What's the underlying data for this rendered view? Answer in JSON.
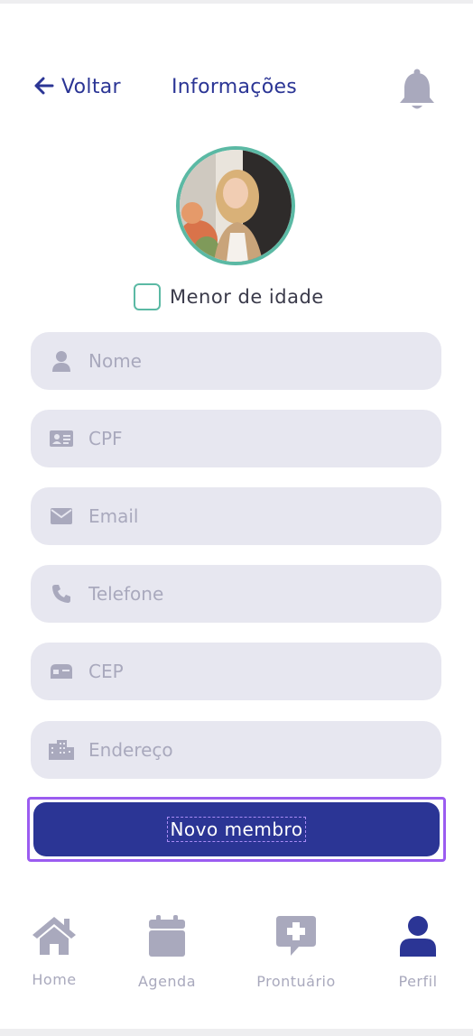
{
  "header": {
    "back_label": "Voltar",
    "title": "Informações"
  },
  "profile": {
    "minor_label": "Menor de idade",
    "minor_checked": false
  },
  "form": {
    "fields": [
      {
        "name": "nome",
        "icon": "user-icon",
        "placeholder": "Nome",
        "value": ""
      },
      {
        "name": "cpf",
        "icon": "id-card-icon",
        "placeholder": "CPF",
        "value": ""
      },
      {
        "name": "email",
        "icon": "envelope-icon",
        "placeholder": "Email",
        "value": ""
      },
      {
        "name": "telefone",
        "icon": "phone-icon",
        "placeholder": "Telefone",
        "value": ""
      },
      {
        "name": "cep",
        "icon": "mailbox-icon",
        "placeholder": "CEP",
        "value": ""
      },
      {
        "name": "endereco",
        "icon": "building-icon",
        "placeholder": "Endereço",
        "value": ""
      }
    ],
    "submit_label": "Novo membro"
  },
  "nav": {
    "tabs": [
      {
        "label": "Home",
        "icon": "home-icon",
        "active": false
      },
      {
        "label": "Agenda",
        "icon": "calendar-icon",
        "active": false
      },
      {
        "label": "Prontuário",
        "icon": "medical-chat-icon",
        "active": false
      },
      {
        "label": "Perfil",
        "icon": "user-icon",
        "active": true
      }
    ]
  },
  "colors": {
    "primary": "#2b3595",
    "accent": "#5bb9a4",
    "field_bg": "#e7e7f0",
    "muted": "#a9a9bd",
    "focus_outline": "#9b5cf0"
  }
}
